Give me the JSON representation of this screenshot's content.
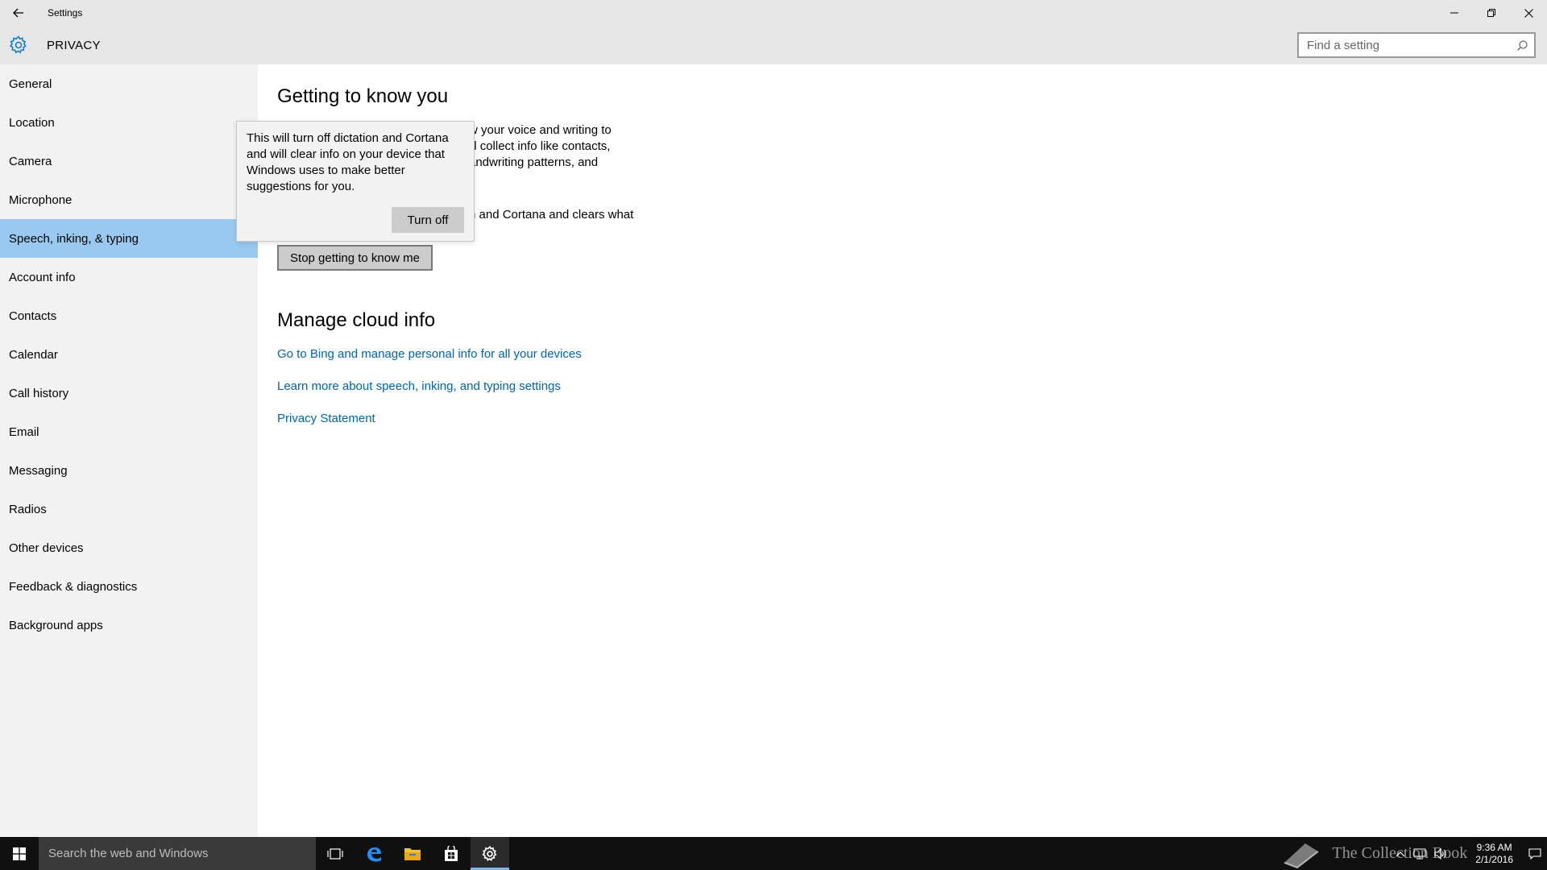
{
  "window": {
    "title": "Settings"
  },
  "header": {
    "section_title": "PRIVACY",
    "search_placeholder": "Find a setting"
  },
  "sidebar": {
    "items": [
      {
        "label": "General"
      },
      {
        "label": "Location"
      },
      {
        "label": "Camera"
      },
      {
        "label": "Microphone"
      },
      {
        "label": "Speech, inking, & typing",
        "selected": true
      },
      {
        "label": "Account info"
      },
      {
        "label": "Contacts"
      },
      {
        "label": "Calendar"
      },
      {
        "label": "Call history"
      },
      {
        "label": "Email"
      },
      {
        "label": "Messaging"
      },
      {
        "label": "Radios"
      },
      {
        "label": "Other devices"
      },
      {
        "label": "Feedback & diagnostics"
      },
      {
        "label": "Background apps"
      }
    ]
  },
  "content": {
    "section1_title": "Getting to know you",
    "para1_fragment": "w your voice and writing to\n'll collect info like contacts,\nandwriting patterns, and",
    "para2_fragment": "n and Cortana and clears what",
    "stop_button": "Stop getting to know me",
    "section2_title": "Manage cloud info",
    "links": {
      "bing": "Go to Bing and manage personal info for all your devices",
      "learn_more": "Learn more about speech, inking, and typing settings",
      "privacy": "Privacy Statement"
    }
  },
  "flyout": {
    "text": "This will turn off dictation and Cortana and will clear info on your device that Windows uses to make better suggestions for you.",
    "button": "Turn off"
  },
  "taskbar": {
    "search_placeholder": "Search the web and Windows",
    "watermark": "The Collection Book",
    "time": "9:36 AM",
    "date": "2/1/2016"
  },
  "colors": {
    "accent": "#0063b1",
    "selected_nav": "#99c9ef",
    "chrome": "#e6e6e6",
    "sidebar": "#f2f2f2"
  }
}
